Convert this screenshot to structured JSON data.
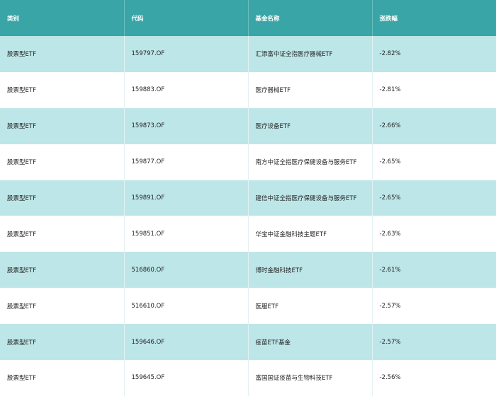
{
  "headers": [
    "类别",
    "代码",
    "基金名称",
    "涨跌幅"
  ],
  "rows": [
    {
      "category": "股票型ETF",
      "code": "159797.OF",
      "name": "汇添富中证全指医疗器械ETF",
      "change": "-2.82%"
    },
    {
      "category": "股票型ETF",
      "code": "159883.OF",
      "name": "医疗器械ETF",
      "change": "-2.81%"
    },
    {
      "category": "股票型ETF",
      "code": "159873.OF",
      "name": "医疗设备ETF",
      "change": "-2.66%"
    },
    {
      "category": "股票型ETF",
      "code": "159877.OF",
      "name": "南方中证全指医疗保健设备与服务ETF",
      "change": "-2.65%"
    },
    {
      "category": "股票型ETF",
      "code": "159891.OF",
      "name": "建信中证全指医疗保健设备与服务ETF",
      "change": "-2.65%"
    },
    {
      "category": "股票型ETF",
      "code": "159851.OF",
      "name": "华宝中证金融科技主题ETF",
      "change": "-2.63%"
    },
    {
      "category": "股票型ETF",
      "code": "516860.OF",
      "name": "博时金融科技ETF",
      "change": "-2.61%"
    },
    {
      "category": "股票型ETF",
      "code": "516610.OF",
      "name": "医服ETF",
      "change": "-2.57%"
    },
    {
      "category": "股票型ETF",
      "code": "159646.OF",
      "name": "疫苗ETF基金",
      "change": "-2.57%"
    },
    {
      "category": "股票型ETF",
      "code": "159645.OF",
      "name": "富国国证疫苗与生物科技ETF",
      "change": "-2.56%"
    }
  ],
  "colors": {
    "header_bg": "#3aa5a6",
    "header_text": "#ffffff",
    "stripe": "#bde6e8",
    "row_bg": "#ffffff"
  }
}
